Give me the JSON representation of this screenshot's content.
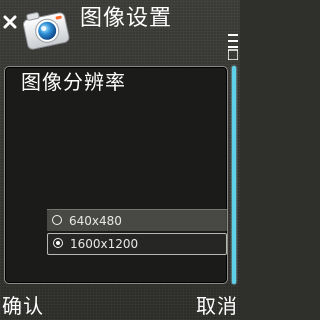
{
  "header": {
    "title": "图像设置",
    "icons": {
      "close": "close-icon",
      "app": "camera-icon",
      "options": "options-menu-icon"
    }
  },
  "dialog": {
    "title": "图像分辨率",
    "options": [
      {
        "label": "640x480",
        "selected": false
      },
      {
        "label": "1600x1200",
        "selected": true
      }
    ]
  },
  "scroll": {
    "position_fraction": 0.0,
    "visible_fraction": 1.0
  },
  "softkeys": {
    "left": "确认",
    "right": "取消"
  },
  "colors": {
    "accent": "#5ed0e8",
    "background": "#2f2f2b",
    "panel": "#1b1b19",
    "text": "#ffffff"
  }
}
